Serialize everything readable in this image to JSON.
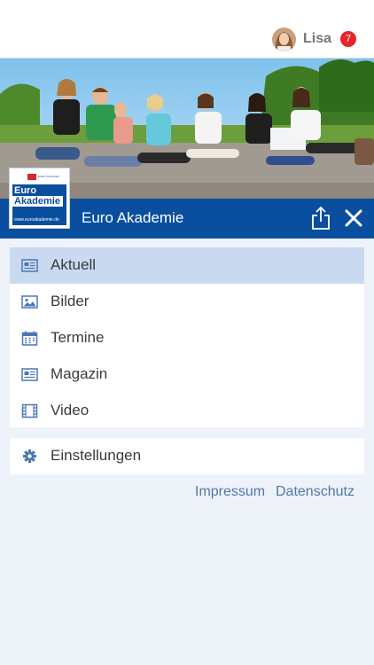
{
  "user": {
    "name": "Lisa",
    "notification_count": "7"
  },
  "app": {
    "title": "Euro Akademie",
    "logo": {
      "line1": "Euro",
      "line2": "Akademie",
      "url": "www.euroakademie.de",
      "tag": "EURO SCHULEN"
    }
  },
  "menu": {
    "items": [
      {
        "label": "Aktuell",
        "icon": "newspaper-icon",
        "active": true
      },
      {
        "label": "Bilder",
        "icon": "image-icon",
        "active": false
      },
      {
        "label": "Termine",
        "icon": "calendar-icon",
        "active": false
      },
      {
        "label": "Magazin",
        "icon": "newspaper-icon",
        "active": false
      },
      {
        "label": "Video",
        "icon": "film-icon",
        "active": false
      }
    ],
    "settings_label": "Einstellungen"
  },
  "footer": {
    "impressum": "Impressum",
    "datenschutz": "Datenschutz"
  },
  "colors": {
    "brand_blue": "#0a4f9e",
    "active_item": "#c9daf0",
    "badge_red": "#e4262a",
    "link": "#4f79a8",
    "icon": "#4b79b2"
  }
}
